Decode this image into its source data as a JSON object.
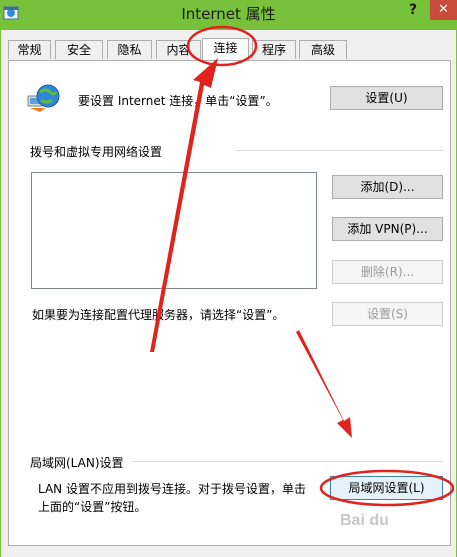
{
  "window": {
    "title": "Internet 属性",
    "help": "?",
    "close": "✕"
  },
  "tabs": [
    {
      "label": "常规"
    },
    {
      "label": "安全"
    },
    {
      "label": "隐私"
    },
    {
      "label": "内容"
    },
    {
      "label": "连接",
      "active": true
    },
    {
      "label": "程序"
    },
    {
      "label": "高级"
    }
  ],
  "setup": {
    "text": "要设置 Internet 连接，单击“设置”。",
    "button": "设置(U)",
    "icon": "globe-network-icon"
  },
  "dialup": {
    "heading": "拨号和虚拟专用网络设置",
    "add_button": "添加(D)...",
    "add_vpn_button": "添加 VPN(P)...",
    "delete_button": "删除(R)...",
    "proxy_text": "如果要为连接配置代理服务器，请选择“设置”。",
    "settings_button": "设置(S)"
  },
  "lan": {
    "heading": "局域网(LAN)设置",
    "text_line1": "LAN 设置不应用到拨号连接。对于拨号设置，单击",
    "text_line2": "上面的“设置”按钮。",
    "button": "局域网设置(L)"
  },
  "watermark": "Bai du",
  "colors": {
    "titlebar": "#78c13a",
    "close": "#c74c3c",
    "annotation": "#e0231c"
  }
}
